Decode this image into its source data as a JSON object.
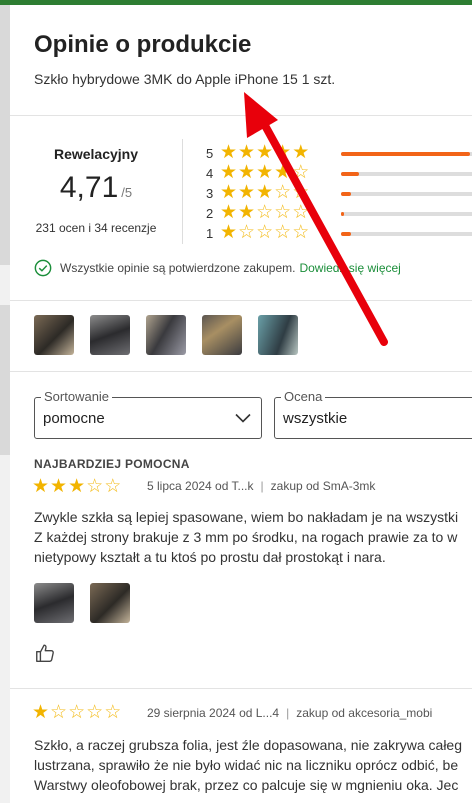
{
  "modal": {
    "title": "Opinie o produkcie",
    "product": "Szkło hybrydowe 3MK do Apple iPhone 15 1 szt."
  },
  "summary": {
    "label": "Rewelacyjny",
    "score": "4,71",
    "max": "/5",
    "count": "231 ocen i 34 recenzje"
  },
  "distribution": [
    {
      "stars": "5",
      "rating": 5,
      "share": 0.92
    },
    {
      "stars": "4",
      "rating": 4,
      "share": 0.13
    },
    {
      "stars": "3",
      "rating": 3,
      "share": 0.07
    },
    {
      "stars": "2",
      "rating": 2,
      "share": 0.02
    },
    {
      "stars": "1",
      "rating": 1,
      "share": 0.07
    }
  ],
  "verify": {
    "text": "Wszystkie opinie są potwierdzone zakupem.",
    "link": "Dowiedz się więcej"
  },
  "filters": {
    "sort": {
      "label": "Sortowanie",
      "value": "pomocne"
    },
    "rating": {
      "label": "Ocena",
      "value": "wszystkie"
    }
  },
  "section_heading": "NAJBARDZIEJ POMOCNA",
  "reviews": [
    {
      "rating": 3,
      "date": "5 lipca 2024 od T...k",
      "source": "zakup od SmA-3mk",
      "lines": [
        "Zwykle szkła są lepiej spasowane, wiem bo nakładam je na wszystki",
        "Z każdej strony brakuje z 3 mm po środku, na rogach prawie za to w",
        "nietypowy kształt a tu ktoś po prostu dał prostokąt i nara."
      ]
    },
    {
      "rating": 1,
      "date": "29 sierpnia 2024 od L...4",
      "source": "zakup od akcesoria_mobi",
      "lines": [
        "Szkło, a raczej grubsza folia, jest źle dopasowana, nie zakrywa całeg",
        "lustrzana, sprawiło że nie było widać nic na liczniku oprócz odbić, be",
        "Warstwy oleofobowej brak, przez co palcuje się w mgnieniu oka. Jec"
      ]
    }
  ],
  "icons": {
    "star_filled": "★",
    "star_empty": "☆",
    "check": "check-circle-icon",
    "chevron": "chevron-down-icon",
    "like": "thumbs-up-icon"
  },
  "colors": {
    "accent_green": "#1b8e3a",
    "star": "#f2b400",
    "bar": "#f26418",
    "annotation_arrow": "#e8000b"
  }
}
